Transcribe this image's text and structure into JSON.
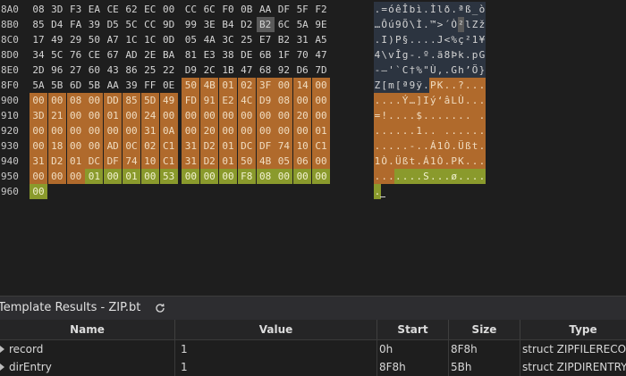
{
  "colors": {
    "background": "#1e1e1e",
    "text": "#d4d4d4",
    "record_highlight": "#b06a2c",
    "record_highlight_text": "#f0dcc0",
    "dirent_highlight": "#8a9a2c",
    "dirent_highlight_text": "#f2f2d0",
    "cursor_highlight": "#5a5a5a",
    "ascii_pane_bg": "#2c3440"
  },
  "hex_rows": [
    {
      "addr": "8A0",
      "bytes": [
        "08",
        "3D",
        "F3",
        "EA",
        "CE",
        "62",
        "EC",
        "00",
        "CC",
        "6C",
        "F0",
        "0B",
        "AA",
        "DF",
        "5F",
        "F2"
      ],
      "ascii": ".=óêÎbì.Ìlð.ªß_ò"
    },
    {
      "addr": "8B0",
      "bytes": [
        "85",
        "D4",
        "FA",
        "39",
        "D5",
        "5C",
        "CC",
        "9D",
        "99",
        "3E",
        "B4",
        "D2",
        "B2",
        "6C",
        "5A",
        "9E"
      ],
      "ascii": "…Ôú9Õ\\Ì.™>´Ò²lZž"
    },
    {
      "addr": "8C0",
      "bytes": [
        "17",
        "49",
        "29",
        "50",
        "A7",
        "1C",
        "1C",
        "0D",
        "05",
        "4A",
        "3C",
        "25",
        "E7",
        "B2",
        "31",
        "A5"
      ],
      "ascii": ".I)P§....J<%ç²1¥"
    },
    {
      "addr": "8D0",
      "bytes": [
        "34",
        "5C",
        "76",
        "CE",
        "67",
        "AD",
        "2E",
        "BA",
        "81",
        "E3",
        "38",
        "DE",
        "6B",
        "1F",
        "70",
        "47"
      ],
      "ascii": "4\\vÎg-.º.ã8Þk.pG"
    },
    {
      "addr": "8E0",
      "bytes": [
        "2D",
        "96",
        "27",
        "60",
        "43",
        "86",
        "25",
        "22",
        "D9",
        "2C",
        "1B",
        "47",
        "68",
        "92",
        "D6",
        "7D"
      ],
      "ascii": "-–'`C†%\"Ù,.Gh’Ö}"
    },
    {
      "addr": "8F0",
      "bytes": [
        "5A",
        "5B",
        "6D",
        "5B",
        "AA",
        "39",
        "FF",
        "0E",
        "50",
        "4B",
        "01",
        "02",
        "3F",
        "00",
        "14",
        "00"
      ],
      "ascii": "Z[m[ª9ÿ.PK..?..."
    },
    {
      "addr": "900",
      "bytes": [
        "00",
        "00",
        "08",
        "00",
        "DD",
        "85",
        "5D",
        "49",
        "FD",
        "91",
        "E2",
        "4C",
        "D9",
        "08",
        "00",
        "00"
      ],
      "ascii": "....Ý…]Iý‘âLÙ..."
    },
    {
      "addr": "910",
      "bytes": [
        "3D",
        "21",
        "00",
        "00",
        "01",
        "00",
        "24",
        "00",
        "00",
        "00",
        "00",
        "00",
        "00",
        "00",
        "20",
        "00"
      ],
      "ascii": "=!....$....... ."
    },
    {
      "addr": "920",
      "bytes": [
        "00",
        "00",
        "00",
        "00",
        "00",
        "00",
        "31",
        "0A",
        "00",
        "20",
        "00",
        "00",
        "00",
        "00",
        "00",
        "01"
      ],
      "ascii": "......1.. ......"
    },
    {
      "addr": "930",
      "bytes": [
        "00",
        "18",
        "00",
        "00",
        "AD",
        "0C",
        "02",
        "C1",
        "31",
        "D2",
        "01",
        "DC",
        "DF",
        "74",
        "10",
        "C1"
      ],
      "ascii": ".....-..Á1Ò.Üßt.Á"
    },
    {
      "addr": "940",
      "bytes": [
        "31",
        "D2",
        "01",
        "DC",
        "DF",
        "74",
        "10",
        "C1",
        "31",
        "D2",
        "01",
        "50",
        "4B",
        "05",
        "06",
        "00"
      ],
      "ascii": "1Ò.Üßt.Á1Ò.PK...."
    },
    {
      "addr": "950",
      "bytes": [
        "00",
        "00",
        "00",
        "01",
        "00",
        "01",
        "00",
        "53",
        "00",
        "00",
        "00",
        "F8",
        "08",
        "00",
        "00",
        "00"
      ],
      "ascii": ".......S...ø...."
    },
    {
      "addr": "960",
      "bytes": [
        "00"
      ],
      "ascii": "."
    }
  ],
  "panel": {
    "title": "Template Results - ZIP.bt",
    "refresh_icon": "refresh-icon"
  },
  "table": {
    "columns": [
      "Name",
      "Value",
      "Start",
      "Size",
      "Type"
    ],
    "rows": [
      {
        "name": "record",
        "value": "1",
        "start": "0h",
        "size": "8F8h",
        "type": "struct ZIPFILERECORD"
      },
      {
        "name": "dirEntry",
        "value": "1",
        "start": "8F8h",
        "size": "5Bh",
        "type": "struct ZIPDIRENTRY"
      }
    ]
  }
}
